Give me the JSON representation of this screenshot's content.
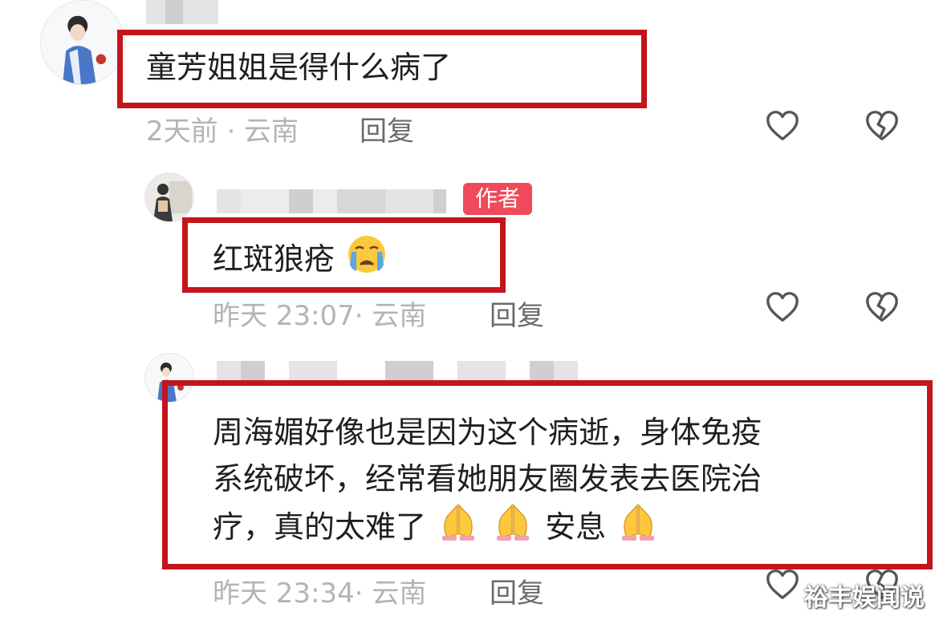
{
  "comments": [
    {
      "text": "童芳姐姐是得什么病了",
      "meta": "2天前 · 云南",
      "reply_label": "回复"
    },
    {
      "author_badge": "作者",
      "text": "红斑狼疮",
      "meta": "昨天 23:07· 云南",
      "reply_label": "回复"
    },
    {
      "text_line1": "周海媚好像也是因为这个病逝，身体免疫",
      "text_line2": "系统破坏，经常看她朋友圈发表去医院治",
      "text_line3_a": "疗，真的太难了",
      "text_line3_b": "安息",
      "meta": "昨天 23:34· 云南",
      "reply_label": "回复"
    }
  ],
  "watermark": "裕丰娱闻说",
  "colors": {
    "highlight_border": "#c3151c",
    "badge": "#f04a5a",
    "meta_text": "#b4b4b4"
  },
  "icons": [
    "heart-outline-icon",
    "broken-heart-icon",
    "crying-face-emoji",
    "folded-hands-emoji"
  ]
}
